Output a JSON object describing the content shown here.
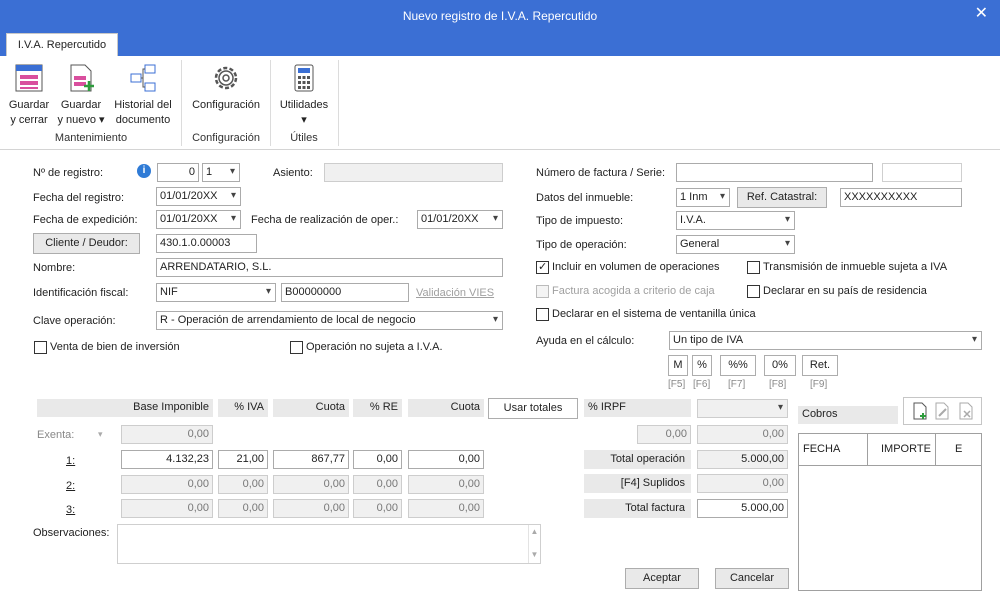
{
  "window": {
    "title": "Nuevo registro de I.V.A. Repercutido",
    "close_glyph": "✕"
  },
  "tab": "I.V.A. Repercutido",
  "ribbon": {
    "groups": [
      "Mantenimiento",
      "Configuración",
      "Útiles"
    ],
    "buttons": {
      "guardar_cerrar": [
        "Guardar",
        "y cerrar"
      ],
      "guardar_nuevo": [
        "Guardar",
        "y nuevo ▾"
      ],
      "historial": [
        "Historial del",
        "documento"
      ],
      "configuracion": "Configuración",
      "utilidades": "Utilidades",
      "utilidades_arrow": "▾"
    }
  },
  "left": {
    "num_registro_label": "Nº de registro:",
    "num_registro": "0",
    "num_registro_serie": "1",
    "asiento_label": "Asiento:",
    "asiento": "",
    "fecha_registro_label": "Fecha del registro:",
    "fecha_registro": "01/01/20XX",
    "fecha_expedicion_label": "Fecha de expedición:",
    "fecha_expedicion": "01/01/20XX",
    "fecha_realizacion_label": "Fecha de realización de oper.:",
    "fecha_realizacion": "01/01/20XX",
    "cliente_button": "Cliente / Deudor:",
    "cliente": "430.1.0.00003",
    "nombre_label": "Nombre:",
    "nombre": "ARRENDATARIO, S.L.",
    "identificacion_label": "Identificación fiscal:",
    "identificacion_tipo": "NIF",
    "identificacion": "B00000000",
    "validacion_vies": "Validación VIES",
    "clave_label": "Clave operación:",
    "clave": "R - Operación de arrendamiento de local de negocio",
    "venta_bien_inversion": "Venta de bien de inversión",
    "operacion_no_sujeta": "Operación no sujeta a I.V.A."
  },
  "right": {
    "num_factura_label": "Número de factura / Serie:",
    "num_factura": "",
    "serie": "",
    "inmueble_label": "Datos del inmueble:",
    "inmueble": "1 Inm",
    "ref_catastral_button": "Ref. Catastral:",
    "ref_catastral": "XXXXXXXXXX",
    "tipo_impuesto_label": "Tipo de impuesto:",
    "tipo_impuesto": "I.V.A.",
    "tipo_operacion_label": "Tipo de operación:",
    "tipo_operacion": "General",
    "incluir_volumen": "Incluir en volumen de operaciones",
    "transmision_inmueble": "Transmisión de inmueble sujeta a IVA",
    "factura_acogida": "Factura acogida a criterio de caja",
    "declarar_pais": "Declarar en su país de residencia",
    "declarar_ventanilla": "Declarar en el sistema de ventanilla única",
    "ayuda_label": "Ayuda en el cálculo:",
    "ayuda": "Un tipo de IVA",
    "calc_buttons": [
      {
        "label": "M",
        "key": "[F5]"
      },
      {
        "label": "%",
        "key": "[F6]"
      },
      {
        "label": "%%",
        "key": "[F7]"
      },
      {
        "label": "0%",
        "key": "[F8]"
      },
      {
        "label": "Ret.",
        "key": "[F9]"
      }
    ]
  },
  "table": {
    "headers": {
      "base": "Base Imponible",
      "iva": "% IVA",
      "cuota": "Cuota",
      "re": "% RE",
      "cuota_re": "Cuota",
      "usar_totales": "Usar totales",
      "irpf": "% IRPF"
    },
    "exenta_label": "Exenta:",
    "exenta_base": "0,00",
    "rows": [
      {
        "label": "1:",
        "base": "4.132,23",
        "iva": "21,00",
        "cuota": "867,77",
        "re": "0,00",
        "cuota_re": "0,00"
      },
      {
        "label": "2:",
        "base": "0,00",
        "iva": "0,00",
        "cuota": "0,00",
        "re": "0,00",
        "cuota_re": "0,00"
      },
      {
        "label": "3:",
        "base": "0,00",
        "iva": "0,00",
        "cuota": "0,00",
        "re": "0,00",
        "cuota_re": "0,00"
      }
    ],
    "irpf_base": "0,00",
    "irpf_cuota": "0,00",
    "total_operacion_label": "Total operación",
    "total_operacion": "5.000,00",
    "suplidos_label": "[F4] Suplidos",
    "suplidos": "0,00",
    "total_factura_label": "Total factura",
    "total_factura": "5.000,00"
  },
  "observaciones_label": "Observaciones:",
  "observaciones": "",
  "cobros": {
    "title": "Cobros",
    "columns": [
      "FECHA",
      "IMPORTE",
      "E"
    ]
  },
  "footer": {
    "aceptar": "Aceptar",
    "cancelar": "Cancelar"
  },
  "colors": {
    "titlebar": "#3b6fd4",
    "info_icon": "#2f7bd6",
    "link_disabled": "#a0a0a0"
  }
}
